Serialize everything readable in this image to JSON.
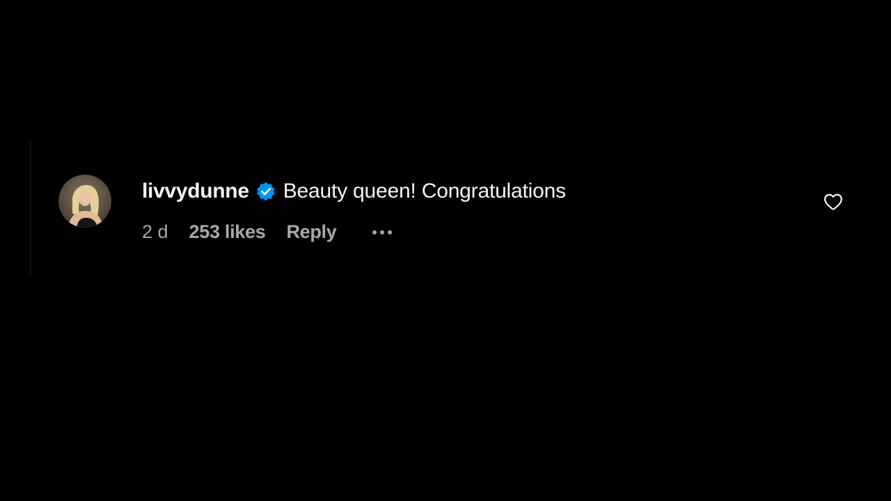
{
  "comment": {
    "username": "livvydunne",
    "verified": true,
    "text": "Beauty queen! Congratulations",
    "time": "2 d",
    "likes": "253 likes",
    "reply_label": "Reply"
  },
  "icons": {
    "verified": "verified-badge-icon",
    "more": "more-options-icon",
    "like": "heart-outline-icon"
  },
  "colors": {
    "background": "#000000",
    "primary_text": "#f5f5f5",
    "secondary_text": "#a8a8a8",
    "verified_blue": "#0095f6"
  }
}
